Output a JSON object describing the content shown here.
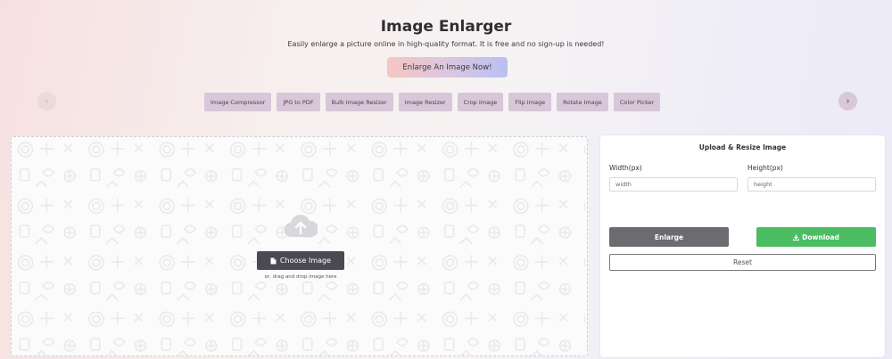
{
  "hero": {
    "title": "Image Enlarger",
    "subtitle": "Easily enlarge a picture online in high-quality format. It is free and no sign-up is needed!",
    "cta_label": "Enlarge An Image Now!"
  },
  "tools_nav": {
    "prev_icon": "chevron-left-icon",
    "next_icon": "chevron-right-icon",
    "prev_glyph": "‹",
    "next_glyph": "›",
    "items": [
      {
        "label": "Image Compressor"
      },
      {
        "label": "JPG to PDF"
      },
      {
        "label": "Bulk Image Resizer"
      },
      {
        "label": "Image Resizer"
      },
      {
        "label": "Crop Image"
      },
      {
        "label": "Flip Image"
      },
      {
        "label": "Rotate Image"
      },
      {
        "label": "Color Picker"
      }
    ]
  },
  "upload": {
    "icon": "cloud-upload-icon",
    "choose_label": "Choose Image",
    "choose_icon": "file-icon",
    "drag_hint": "or, drag and drop image here"
  },
  "panel": {
    "title": "Upload & Resize Image",
    "width_label": "Width(px)",
    "width_placeholder": "width",
    "width_value": "",
    "height_label": "Height(px)",
    "height_placeholder": "height",
    "height_value": "",
    "enlarge_label": "Enlarge",
    "download_label": "Download",
    "download_icon": "download-icon",
    "reset_label": "Reset"
  },
  "colors": {
    "download_green": "#4cbd63",
    "enlarge_gray": "#6b6c70",
    "tool_chip": "#d8c6d9",
    "choose_dark": "#4a4a55"
  }
}
